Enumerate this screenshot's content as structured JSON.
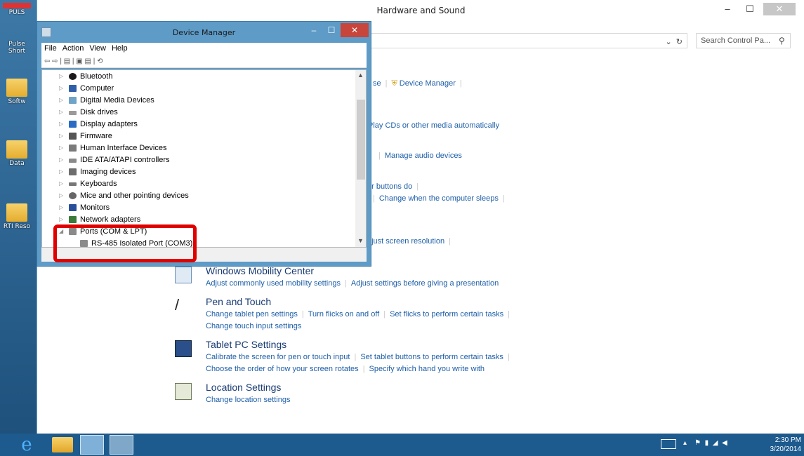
{
  "desktop": {
    "icons": [
      {
        "label": "PULS"
      },
      {
        "label": "Pulse Short"
      },
      {
        "label": "Softw"
      },
      {
        "label": "Data"
      },
      {
        "label": "RTI Reso"
      }
    ]
  },
  "control_panel": {
    "title": "Hardware and Sound",
    "search_placeholder": "Search Control Pa...",
    "partial_links": {
      "device_row": "se",
      "device_manager": "Device Manager",
      "autoplay": "Play CDs or other media automatically",
      "manage_audio": "Manage audio devices",
      "power_buttons": "er buttons do",
      "sleep": "Change when the computer sleeps",
      "screen_res": "djust screen resolution"
    },
    "sections": [
      {
        "title": "Windows Mobility Center",
        "links_line1": [
          "Adjust commonly used mobility settings",
          "Adjust settings before giving a presentation"
        ],
        "links_line2": []
      },
      {
        "title": "Pen and Touch",
        "links_line1": [
          "Change tablet pen settings",
          "Turn flicks on and off",
          "Set flicks to perform certain tasks"
        ],
        "links_line2": [
          "Change touch input settings"
        ]
      },
      {
        "title": "Tablet PC Settings",
        "links_line1": [
          "Calibrate the screen for pen or touch input",
          "Set tablet buttons to perform certain tasks"
        ],
        "links_line2": [
          "Choose the order of how your screen rotates",
          "Specify which hand you write with"
        ]
      },
      {
        "title": "Location Settings",
        "links_line1": [
          "Change location settings"
        ],
        "links_line2": []
      }
    ]
  },
  "device_manager": {
    "title": "Device Manager",
    "menu": [
      "File",
      "Action",
      "View",
      "Help"
    ],
    "toolbar_glyphs": "⇦ ⇨ | ▤ | ▣ ▤ | ⟲",
    "tree": [
      {
        "label": "Bluetooth",
        "color": "#1a1a1a"
      },
      {
        "label": "Computer",
        "color": "#2f5fa8"
      },
      {
        "label": "Digital Media Devices",
        "color": "#6fa3c8"
      },
      {
        "label": "Disk drives",
        "color": "#9a9a9a"
      },
      {
        "label": "Display adapters",
        "color": "#2a6bc4"
      },
      {
        "label": "Firmware",
        "color": "#555555"
      },
      {
        "label": "Human Interface Devices",
        "color": "#7a7a7a"
      },
      {
        "label": "IDE ATA/ATAPI controllers",
        "color": "#8a8a8a"
      },
      {
        "label": "Imaging devices",
        "color": "#6d6d6d"
      },
      {
        "label": "Keyboards",
        "color": "#777777"
      },
      {
        "label": "Mice and other pointing devices",
        "color": "#666666"
      },
      {
        "label": "Monitors",
        "color": "#2a4f9a"
      },
      {
        "label": "Network adapters",
        "color": "#3b7a3b"
      },
      {
        "label": "Ports (COM & LPT)",
        "color": "#8a8a8a"
      },
      {
        "label": "RS-485 Isolated Port (COM3)",
        "color": "#8a8a8a"
      }
    ]
  },
  "taskbar": {
    "time": "2:30 PM",
    "date": "3/20/2014"
  }
}
